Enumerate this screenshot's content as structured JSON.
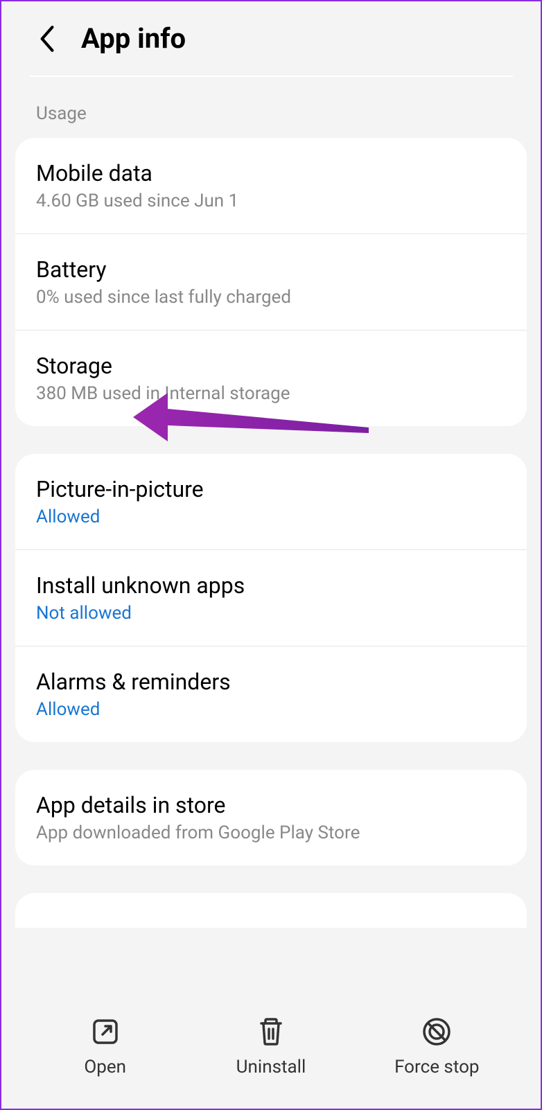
{
  "header": {
    "title": "App info"
  },
  "section_label": "Usage",
  "usage": {
    "mobile_data": {
      "title": "Mobile data",
      "subtitle": "4.60 GB used since Jun 1"
    },
    "battery": {
      "title": "Battery",
      "subtitle": "0% used since last fully charged"
    },
    "storage": {
      "title": "Storage",
      "subtitle": "380 MB used in Internal storage"
    }
  },
  "permissions": {
    "pip": {
      "title": "Picture-in-picture",
      "status": "Allowed"
    },
    "unknown_apps": {
      "title": "Install unknown apps",
      "status": "Not allowed"
    },
    "alarms": {
      "title": "Alarms & reminders",
      "status": "Allowed"
    }
  },
  "store": {
    "title": "App details in store",
    "subtitle": "App downloaded from Google Play Store"
  },
  "bottom": {
    "open": "Open",
    "uninstall": "Uninstall",
    "force_stop": "Force stop"
  }
}
